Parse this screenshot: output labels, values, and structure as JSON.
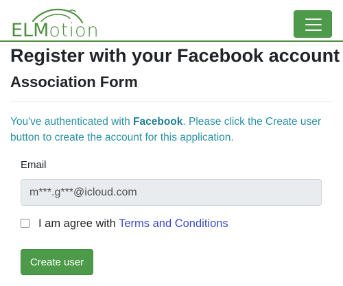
{
  "brand": {
    "logo_text_a": "ELM",
    "logo_text_b": "otion",
    "icon": "car-outline-logo"
  },
  "navbar": {
    "toggler_icon": "hamburger-menu-icon"
  },
  "page": {
    "title": "Register with your Facebook account",
    "subtitle": "Association Form"
  },
  "info": {
    "prefix": "You've authenticated with ",
    "provider": "Facebook",
    "suffix": ". Please click the Create user button to create the account for this application."
  },
  "form": {
    "email_label": "Email",
    "email_value": "m***.g***@icloud.com",
    "agree_text": "I am agree with ",
    "terms_link": "Terms and Conditions",
    "submit_label": "Create user"
  },
  "colors": {
    "brand_green": "#4d8f3f",
    "button_green": "#4d9b4a",
    "info_teal": "#2a8fa3",
    "link_blue": "#3b4cc0"
  }
}
